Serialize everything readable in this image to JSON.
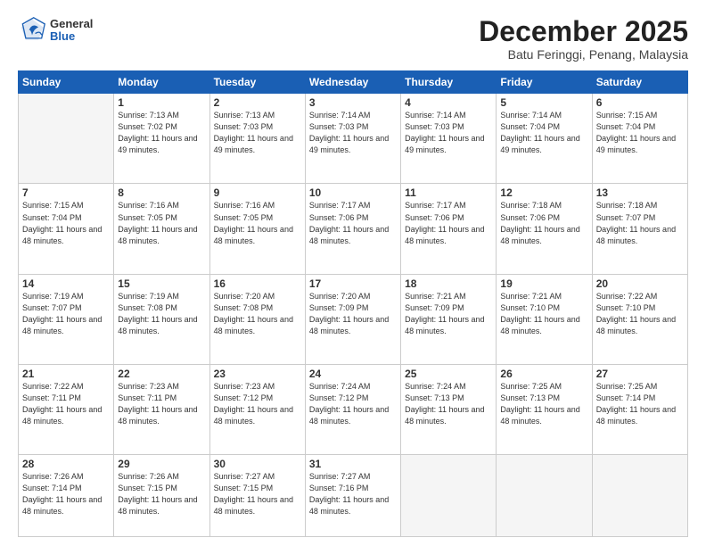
{
  "logo": {
    "general": "General",
    "blue": "Blue"
  },
  "header": {
    "month": "December 2025",
    "location": "Batu Feringgi, Penang, Malaysia"
  },
  "weekdays": [
    "Sunday",
    "Monday",
    "Tuesday",
    "Wednesday",
    "Thursday",
    "Friday",
    "Saturday"
  ],
  "weeks": [
    [
      {
        "day": null,
        "sunrise": null,
        "sunset": null,
        "daylight": null
      },
      {
        "day": "1",
        "sunrise": "Sunrise: 7:13 AM",
        "sunset": "Sunset: 7:02 PM",
        "daylight": "Daylight: 11 hours and 49 minutes."
      },
      {
        "day": "2",
        "sunrise": "Sunrise: 7:13 AM",
        "sunset": "Sunset: 7:03 PM",
        "daylight": "Daylight: 11 hours and 49 minutes."
      },
      {
        "day": "3",
        "sunrise": "Sunrise: 7:14 AM",
        "sunset": "Sunset: 7:03 PM",
        "daylight": "Daylight: 11 hours and 49 minutes."
      },
      {
        "day": "4",
        "sunrise": "Sunrise: 7:14 AM",
        "sunset": "Sunset: 7:03 PM",
        "daylight": "Daylight: 11 hours and 49 minutes."
      },
      {
        "day": "5",
        "sunrise": "Sunrise: 7:14 AM",
        "sunset": "Sunset: 7:04 PM",
        "daylight": "Daylight: 11 hours and 49 minutes."
      },
      {
        "day": "6",
        "sunrise": "Sunrise: 7:15 AM",
        "sunset": "Sunset: 7:04 PM",
        "daylight": "Daylight: 11 hours and 49 minutes."
      }
    ],
    [
      {
        "day": "7",
        "sunrise": "Sunrise: 7:15 AM",
        "sunset": "Sunset: 7:04 PM",
        "daylight": "Daylight: 11 hours and 48 minutes."
      },
      {
        "day": "8",
        "sunrise": "Sunrise: 7:16 AM",
        "sunset": "Sunset: 7:05 PM",
        "daylight": "Daylight: 11 hours and 48 minutes."
      },
      {
        "day": "9",
        "sunrise": "Sunrise: 7:16 AM",
        "sunset": "Sunset: 7:05 PM",
        "daylight": "Daylight: 11 hours and 48 minutes."
      },
      {
        "day": "10",
        "sunrise": "Sunrise: 7:17 AM",
        "sunset": "Sunset: 7:06 PM",
        "daylight": "Daylight: 11 hours and 48 minutes."
      },
      {
        "day": "11",
        "sunrise": "Sunrise: 7:17 AM",
        "sunset": "Sunset: 7:06 PM",
        "daylight": "Daylight: 11 hours and 48 minutes."
      },
      {
        "day": "12",
        "sunrise": "Sunrise: 7:18 AM",
        "sunset": "Sunset: 7:06 PM",
        "daylight": "Daylight: 11 hours and 48 minutes."
      },
      {
        "day": "13",
        "sunrise": "Sunrise: 7:18 AM",
        "sunset": "Sunset: 7:07 PM",
        "daylight": "Daylight: 11 hours and 48 minutes."
      }
    ],
    [
      {
        "day": "14",
        "sunrise": "Sunrise: 7:19 AM",
        "sunset": "Sunset: 7:07 PM",
        "daylight": "Daylight: 11 hours and 48 minutes."
      },
      {
        "day": "15",
        "sunrise": "Sunrise: 7:19 AM",
        "sunset": "Sunset: 7:08 PM",
        "daylight": "Daylight: 11 hours and 48 minutes."
      },
      {
        "day": "16",
        "sunrise": "Sunrise: 7:20 AM",
        "sunset": "Sunset: 7:08 PM",
        "daylight": "Daylight: 11 hours and 48 minutes."
      },
      {
        "day": "17",
        "sunrise": "Sunrise: 7:20 AM",
        "sunset": "Sunset: 7:09 PM",
        "daylight": "Daylight: 11 hours and 48 minutes."
      },
      {
        "day": "18",
        "sunrise": "Sunrise: 7:21 AM",
        "sunset": "Sunset: 7:09 PM",
        "daylight": "Daylight: 11 hours and 48 minutes."
      },
      {
        "day": "19",
        "sunrise": "Sunrise: 7:21 AM",
        "sunset": "Sunset: 7:10 PM",
        "daylight": "Daylight: 11 hours and 48 minutes."
      },
      {
        "day": "20",
        "sunrise": "Sunrise: 7:22 AM",
        "sunset": "Sunset: 7:10 PM",
        "daylight": "Daylight: 11 hours and 48 minutes."
      }
    ],
    [
      {
        "day": "21",
        "sunrise": "Sunrise: 7:22 AM",
        "sunset": "Sunset: 7:11 PM",
        "daylight": "Daylight: 11 hours and 48 minutes."
      },
      {
        "day": "22",
        "sunrise": "Sunrise: 7:23 AM",
        "sunset": "Sunset: 7:11 PM",
        "daylight": "Daylight: 11 hours and 48 minutes."
      },
      {
        "day": "23",
        "sunrise": "Sunrise: 7:23 AM",
        "sunset": "Sunset: 7:12 PM",
        "daylight": "Daylight: 11 hours and 48 minutes."
      },
      {
        "day": "24",
        "sunrise": "Sunrise: 7:24 AM",
        "sunset": "Sunset: 7:12 PM",
        "daylight": "Daylight: 11 hours and 48 minutes."
      },
      {
        "day": "25",
        "sunrise": "Sunrise: 7:24 AM",
        "sunset": "Sunset: 7:13 PM",
        "daylight": "Daylight: 11 hours and 48 minutes."
      },
      {
        "day": "26",
        "sunrise": "Sunrise: 7:25 AM",
        "sunset": "Sunset: 7:13 PM",
        "daylight": "Daylight: 11 hours and 48 minutes."
      },
      {
        "day": "27",
        "sunrise": "Sunrise: 7:25 AM",
        "sunset": "Sunset: 7:14 PM",
        "daylight": "Daylight: 11 hours and 48 minutes."
      }
    ],
    [
      {
        "day": "28",
        "sunrise": "Sunrise: 7:26 AM",
        "sunset": "Sunset: 7:14 PM",
        "daylight": "Daylight: 11 hours and 48 minutes."
      },
      {
        "day": "29",
        "sunrise": "Sunrise: 7:26 AM",
        "sunset": "Sunset: 7:15 PM",
        "daylight": "Daylight: 11 hours and 48 minutes."
      },
      {
        "day": "30",
        "sunrise": "Sunrise: 7:27 AM",
        "sunset": "Sunset: 7:15 PM",
        "daylight": "Daylight: 11 hours and 48 minutes."
      },
      {
        "day": "31",
        "sunrise": "Sunrise: 7:27 AM",
        "sunset": "Sunset: 7:16 PM",
        "daylight": "Daylight: 11 hours and 48 minutes."
      },
      {
        "day": null,
        "sunrise": null,
        "sunset": null,
        "daylight": null
      },
      {
        "day": null,
        "sunrise": null,
        "sunset": null,
        "daylight": null
      },
      {
        "day": null,
        "sunrise": null,
        "sunset": null,
        "daylight": null
      }
    ]
  ]
}
